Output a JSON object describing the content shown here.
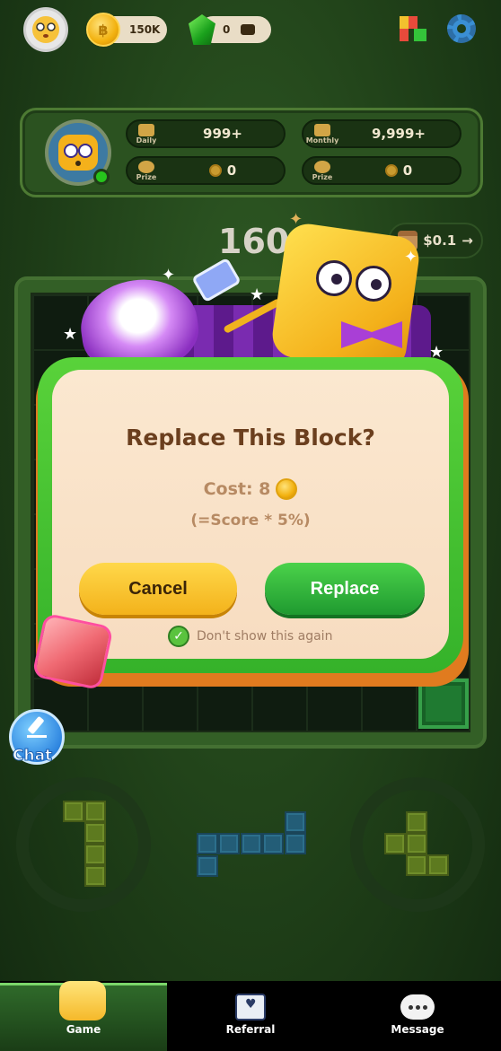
{
  "header": {
    "coins": "150K",
    "gems": "0",
    "avatar_icon": "dizzy-face",
    "icons": [
      "coin-icon",
      "gem-icon",
      "wallet-icon",
      "apps-icon",
      "settings-gear-icon"
    ]
  },
  "stats": {
    "daily_label": "Daily",
    "daily_value": "999+",
    "monthly_label": "Monthly",
    "monthly_value": "9,999+",
    "prize_label": "Prize",
    "prize_left_value": "0",
    "prize_right_value": "0"
  },
  "game": {
    "score": "160",
    "prize_amount": "$0.1",
    "prize_arrow": "→"
  },
  "dialog": {
    "title": "Replace This Block?",
    "cost_label": "Cost: 8",
    "formula": "(=Score * 5%)",
    "cancel_label": "Cancel",
    "replace_label": "Replace",
    "dont_show_label": "Don't show this again",
    "dont_show_checked": true
  },
  "chat": {
    "label": "Chat"
  },
  "bottom_nav": {
    "items": [
      {
        "label": "Game",
        "active": true
      },
      {
        "label": "Referral",
        "active": false
      },
      {
        "label": "Message",
        "active": false
      }
    ]
  },
  "colors": {
    "accent_green": "#35b22a",
    "cancel_yellow": "#f3b21b",
    "dialog_cream": "#fbe8d0",
    "title_brown": "#6b3f1e"
  }
}
